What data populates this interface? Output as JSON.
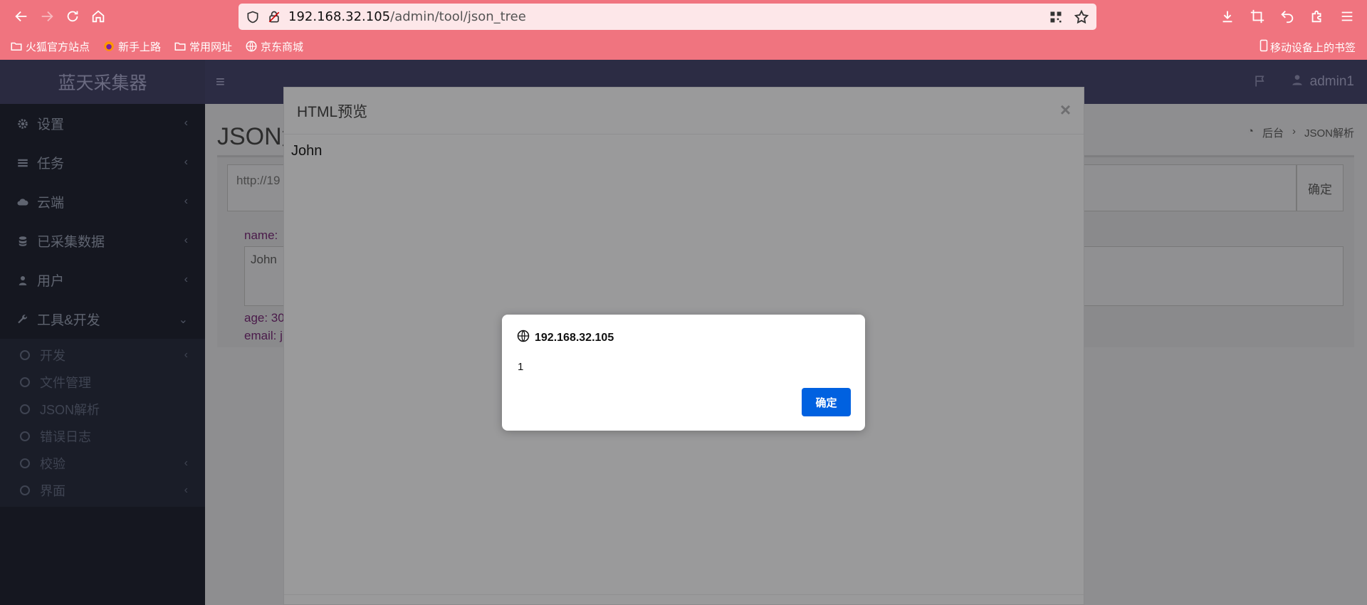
{
  "browser": {
    "url_host": "192.168.32.105",
    "url_path": "/admin/tool/json_tree",
    "bookmarks": [
      "火狐官方站点",
      "新手上路",
      "常用网址",
      "京东商城"
    ],
    "mobile_bookmarks": "移动设备上的书签"
  },
  "app": {
    "logo": "蓝天采集器",
    "user": "admin1",
    "sidebar": [
      {
        "label": "设置"
      },
      {
        "label": "任务"
      },
      {
        "label": "云端"
      },
      {
        "label": "已采集数据"
      },
      {
        "label": "用户"
      },
      {
        "label": "工具&开发"
      }
    ],
    "subitems": [
      {
        "label": "开发"
      },
      {
        "label": "文件管理"
      },
      {
        "label": "JSON解析"
      },
      {
        "label": "错误日志"
      },
      {
        "label": "校验"
      },
      {
        "label": "界面"
      }
    ],
    "page_title": "JSON解",
    "breadcrumb": [
      "后台",
      "JSON解析"
    ],
    "url_value": "http://19",
    "confirm_label": "确定",
    "fields": {
      "name_label": "name:",
      "name_value": "John",
      "age_label": "age: 30",
      "email_label": "email: j"
    }
  },
  "modal": {
    "title": "HTML预览",
    "body": "John"
  },
  "alert": {
    "origin": "192.168.32.105",
    "message": "1",
    "ok_label": "确定"
  }
}
